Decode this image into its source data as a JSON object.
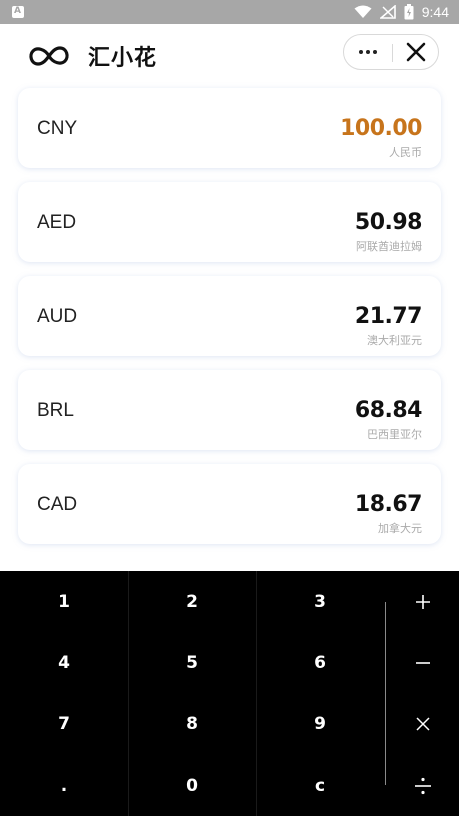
{
  "status_bar": {
    "notification_icon": "notification-a-icon",
    "notification_letter": "A",
    "time": "9:44",
    "icons": [
      "wifi-icon",
      "signal-icon",
      "battery-icon"
    ]
  },
  "header": {
    "logo_icon": "infinity-logo-icon",
    "title": "汇小花",
    "more_icon": "more-dots-icon",
    "close_icon": "close-icon"
  },
  "currencies": [
    {
      "code": "CNY",
      "value": "100.00",
      "name": "人民币",
      "active": true
    },
    {
      "code": "AED",
      "value": "50.98",
      "name": "阿联酋迪拉姆",
      "active": false
    },
    {
      "code": "AUD",
      "value": "21.77",
      "name": "澳大利亚元",
      "active": false
    },
    {
      "code": "BRL",
      "value": "68.84",
      "name": "巴西里亚尔",
      "active": false
    },
    {
      "code": "CAD",
      "value": "18.67",
      "name": "加拿大元",
      "active": false
    }
  ],
  "colors": {
    "active_value": "#c7741b",
    "keypad_bg": "#000000",
    "status_bar_bg": "#a7a7a7"
  },
  "keypad": {
    "keys": [
      [
        "1",
        "2",
        "3"
      ],
      [
        "4",
        "5",
        "6"
      ],
      [
        "7",
        "8",
        "9"
      ],
      [
        ".",
        "0",
        "c"
      ]
    ],
    "operators": [
      "plus-icon",
      "minus-icon",
      "multiply-icon",
      "divide-icon"
    ]
  }
}
